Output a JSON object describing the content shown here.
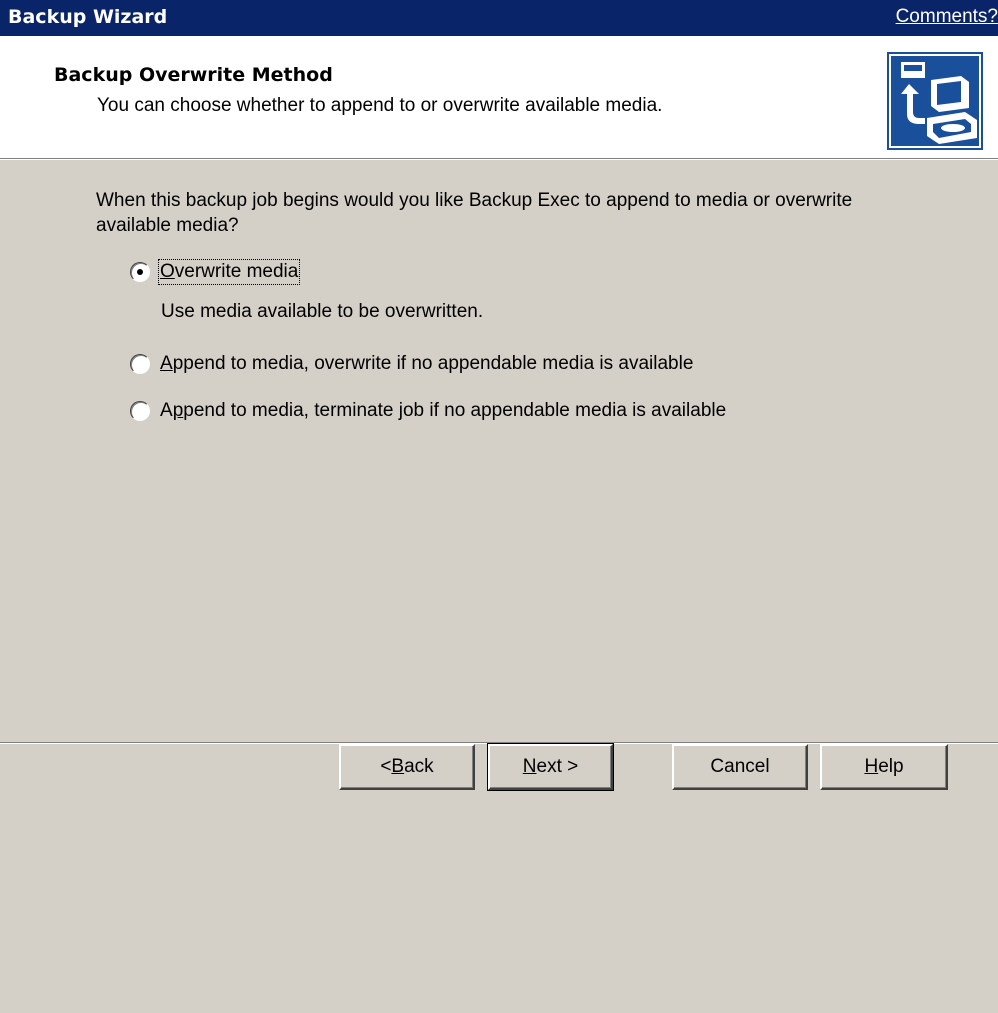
{
  "window": {
    "title": "Backup Wizard",
    "comments_link": "Comments?"
  },
  "header": {
    "title": "Backup Overwrite Method",
    "subtitle": "You can choose whether to append to or overwrite available media.",
    "icon": "backup-computer-icon"
  },
  "body": {
    "question": "When this backup job begins would you like Backup Exec to append to media or overwrite available media?",
    "options": [
      {
        "label": "Overwrite media",
        "mnemonic": "O",
        "label_rest": "verwrite media",
        "checked": true,
        "description": "Use media available to be overwritten."
      },
      {
        "label": "Append to media, overwrite if no appendable media is available",
        "mnemonic": "A",
        "label_rest": "ppend to media, overwrite if no appendable media is available",
        "checked": false
      },
      {
        "label": "Append to media, terminate job if no appendable media is available",
        "prefix": "A",
        "mnemonic": "p",
        "label_rest": "pend to media, terminate job if no appendable media is available",
        "checked": false
      }
    ]
  },
  "footer": {
    "back_prefix": "< ",
    "back_mnemonic": "B",
    "back_rest": "ack",
    "next_mnemonic": "N",
    "next_rest": "ext >",
    "cancel": "Cancel",
    "help_mnemonic": "H",
    "help_rest": "elp"
  },
  "colors": {
    "titlebar": "#0a246a",
    "face": "#d4d0c8",
    "header_bg": "#ffffff",
    "icon_bg": "#1a4f9c"
  }
}
